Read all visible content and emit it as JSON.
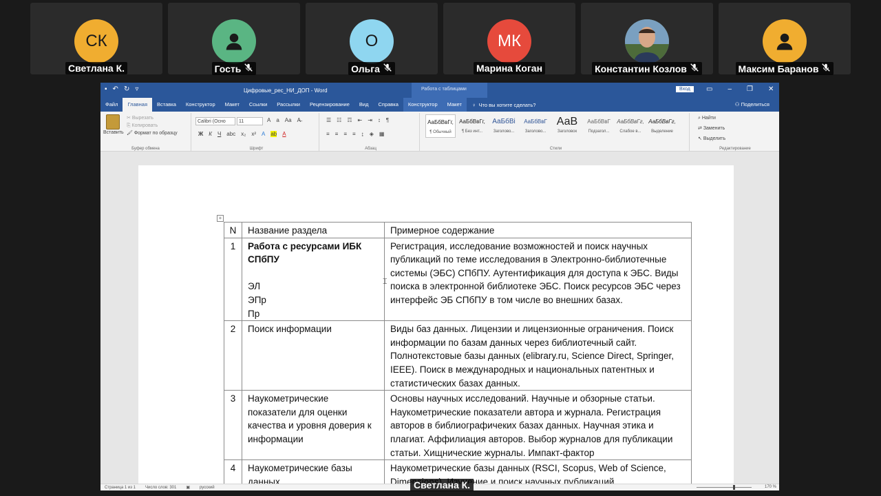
{
  "participants": [
    {
      "name": "Светлана К.",
      "initials": "СК",
      "avatar_color": "#f0ad30",
      "muted": false
    },
    {
      "name": "Гость",
      "initials": "",
      "avatar_color": "#5ab583",
      "muted": true,
      "icon": "person-icon"
    },
    {
      "name": "Ольга",
      "initials": "О",
      "avatar_color": "#8fd6f0",
      "muted": true
    },
    {
      "name": "Марина Коган",
      "initials": "МК",
      "avatar_color": "#e64a3c",
      "muted": false
    },
    {
      "name": "Константин Козлов",
      "initials": "",
      "avatar_color": "#7a8f5a",
      "muted": true,
      "icon": "photo-avatar"
    },
    {
      "name": "Максим Баранов",
      "initials": "",
      "avatar_color": "#f0ad30",
      "muted": true,
      "icon": "person-icon"
    }
  ],
  "word": {
    "doc_title": "Цифровые_рес_НИ_ДОП - Word",
    "context_title": "Работа с таблицами",
    "login": "Вход",
    "tabs": [
      "Файл",
      "Главная",
      "Вставка",
      "Конструктор",
      "Макет",
      "Ссылки",
      "Рассылки",
      "Рецензирование",
      "Вид",
      "Справка"
    ],
    "context_tabs": [
      "Конструктор",
      "Макет"
    ],
    "tell_me": "Что вы хотите сделать?",
    "share": "Поделиться",
    "clipboard": {
      "paste": "Вставить",
      "cut": "Вырезать",
      "copy": "Копировать",
      "format_painter": "Формат по образцу",
      "label": "Буфер обмена"
    },
    "font": {
      "name": "Calibri (Осно",
      "size": "11",
      "label": "Шрифт"
    },
    "paragraph_label": "Абзац",
    "styles": [
      {
        "sample": "АаБбВвГг,",
        "name": "¶ Обычный"
      },
      {
        "sample": "АаБбВвГг,",
        "name": "¶ Без инт..."
      },
      {
        "sample": "АаБбВі",
        "name": "Заголово..."
      },
      {
        "sample": "АаБбВвГ",
        "name": "Заголово..."
      },
      {
        "sample": "АаВ",
        "name": "Заголовок"
      },
      {
        "sample": "АаБбВвГ",
        "name": "Подзагол..."
      },
      {
        "sample": "АаБбВвГг,",
        "name": "Слабое в..."
      },
      {
        "sample": "АаБбВвГг,",
        "name": "Выделение"
      }
    ],
    "styles_label": "Стили",
    "editing": {
      "find": "Найти",
      "replace": "Заменить",
      "select": "Выделить",
      "label": "Редактирование"
    },
    "status": {
      "page": "Страница 1 из 1",
      "words": "Число слов: 301",
      "lang": "русский",
      "zoom": "170 %"
    }
  },
  "table": {
    "headers": [
      "N",
      "Название раздела",
      "Примерное содержание"
    ],
    "rows": [
      {
        "n": "1",
        "title_bold": "Работа с ресурсами ИБК СПбПУ",
        "extra": [
          "ЭЛ",
          "ЭПр",
          "Пр"
        ],
        "content": "Регистрация, исследование возможностей и поиск научных публикаций по теме исследования в Электронно-библиотечные системы (ЭБС) СПбПУ. Аутентификация для доступа к ЭБС. Виды поиска в электронной библиотеке ЭБС. Поиск ресурсов ЭБС через интерфейс ЭБ СПбПУ в том числе во внешних базах."
      },
      {
        "n": "2",
        "title": "Поиск информации",
        "content": "Виды баз данных. Лицензии и лицензионные ограничения. Поиск информации по базам данных через библиотечный сайт. Полнотекстовые базы данных (elibrary.ru, Science Direct, Springer, IEEE). Поиск в международных и национальных патентных и статистических базах данных."
      },
      {
        "n": "3",
        "title": "Наукометрические показатели для оценки качества и уровня доверия к информации",
        "content": "Основы научных исследований. Научные и обзорные статьи. Наукометрические показатели автора и журнала. Регистрация авторов в библиографичеких базах данных. Научная этика и плагиат. Аффилиация авторов. Выбор журналов для публикации статьи. Хищнические журналы. Импакт-фактор"
      },
      {
        "n": "4",
        "title": "Наукометрические базы данных",
        "content": "Наукометрические базы данных (RSCI, Scopus, Web of Science, Dimensions). Изучение и поиск научных публикаций"
      }
    ]
  },
  "speaker_label": "Светлана К."
}
